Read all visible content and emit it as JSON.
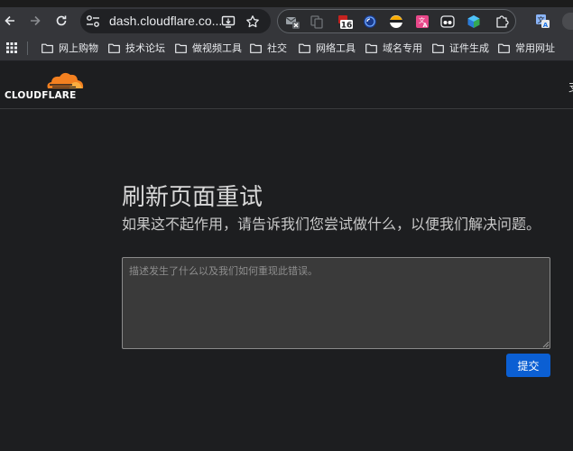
{
  "browser": {
    "url": "dash.cloudflare.co...",
    "extension_badge": "16"
  },
  "bookmarks": [
    {
      "label": "网上购物"
    },
    {
      "label": "技术论坛"
    },
    {
      "label": "做视频工具"
    },
    {
      "label": "社交"
    },
    {
      "label": "网络工具"
    },
    {
      "label": "域名专用"
    },
    {
      "label": "证件生成"
    },
    {
      "label": "常用网址"
    }
  ],
  "header": {
    "logo_text": "CLOUDFLARE",
    "right_text": "支"
  },
  "error": {
    "title": "刷新页面重试",
    "subtitle": "如果这不起作用，请告诉我们您尝试做什么，以便我们解决问题。"
  },
  "feedback": {
    "placeholder": "描述发生了什么以及我们如何重现此错误。",
    "value": ""
  },
  "submit": {
    "label": "提交"
  },
  "colors": {
    "page_bg": "#1d1e20",
    "toolbar_bg": "#35363a",
    "submit_bg": "#0b5fd3",
    "logo_orange": "#f38020"
  }
}
